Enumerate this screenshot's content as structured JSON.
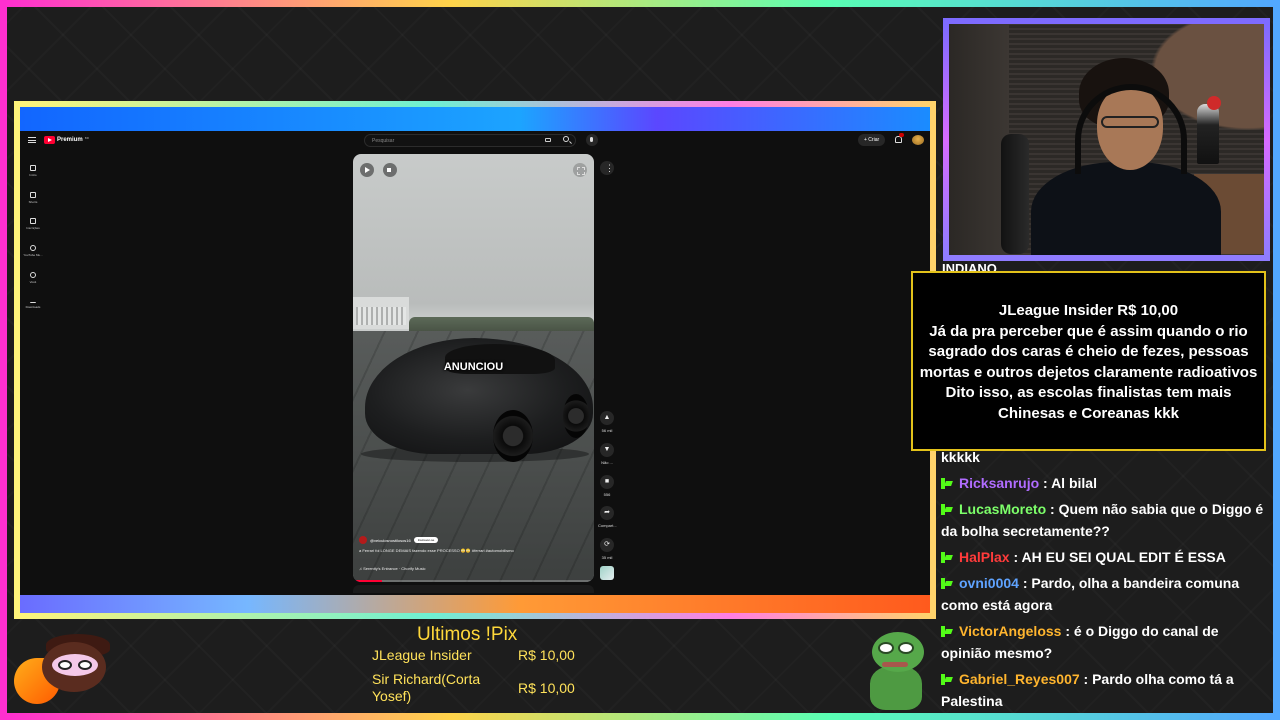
{
  "youtube": {
    "logo_text": "Premium",
    "logo_sup": "BR",
    "search_placeholder": "Pesquisar",
    "create_label": "+ Criar",
    "sidebar": [
      {
        "label": "Início",
        "icon": "home-icon"
      },
      {
        "label": "Shorts",
        "icon": "shorts-icon"
      },
      {
        "label": "Inscrições",
        "icon": "subscriptions-icon"
      },
      {
        "label": "YouTube Mu...",
        "icon": "music-icon"
      },
      {
        "label": "Você",
        "icon": "user-icon"
      },
      {
        "label": "Downloads",
        "icon": "download-icon"
      }
    ],
    "short": {
      "caption": "ANUNCIOU",
      "channel": "@veiculosnostilosos16",
      "subscribe_label": "Inscrever-se",
      "description": "a Ferrari foi LONGE DEMAIS fazendo esse PROCESSO 😳😳 #ferrari #automobilismo",
      "music": "♫ Serenity's Entrance · Chorify Music",
      "progress": 0.12
    },
    "actions": [
      {
        "label": "56 mil",
        "icon": "like-icon",
        "glyph": "▲"
      },
      {
        "label": "Não ...",
        "icon": "dislike-icon",
        "glyph": "▼"
      },
      {
        "label": "556",
        "icon": "comment-icon",
        "glyph": "■"
      },
      {
        "label": "Compart...",
        "icon": "share-icon",
        "glyph": "➦"
      },
      {
        "label": "35 mil",
        "icon": "remix-icon",
        "glyph": "⟳"
      }
    ]
  },
  "alert": {
    "title": "JLeague Insider R$ 10,00",
    "message": "Já da pra perceber que é assim quando o rio sagrado dos caras é cheio de fezes, pessoas mortas e outros dejetos claramente radioativos Dito isso, as escolas finalistas tem mais Chinesas e Coreanas kkk",
    "border_color": "#e3c21a"
  },
  "chat": {
    "partial_username": "INDIANO",
    "partial_line": "kkkkk",
    "messages": [
      {
        "user": "Ricksanrujo",
        "color": "#b06cff",
        "text": "Al bilal"
      },
      {
        "user": "LucasMoreto",
        "color": "#7dff6a",
        "text": "Quem não sabia que o Diggo é da bolha secretamente??"
      },
      {
        "user": "HalPlax",
        "color": "#ff3b3b",
        "text": "AH EU SEI QUAL EDIT É ESSA"
      },
      {
        "user": "ovni0004",
        "color": "#5fa3ff",
        "text": "Pardo, olha a bandeira comuna como está agora"
      },
      {
        "user": "VictorAngeloss",
        "color": "#ffb52e",
        "text": "é o Diggo do canal de opinião mesmo?"
      },
      {
        "user": "Gabriel_Reyes007",
        "color": "#ffb52e",
        "text": "Pardo olha como tá a Palestina"
      }
    ]
  },
  "pix_panel": {
    "title": "Ultimos !Pix",
    "entries": [
      {
        "name": "JLeague Insider",
        "amount": "R$ 10,00"
      },
      {
        "name": "Sir Richard(Corta Yosef)",
        "amount": "R$ 10,00"
      }
    ]
  }
}
